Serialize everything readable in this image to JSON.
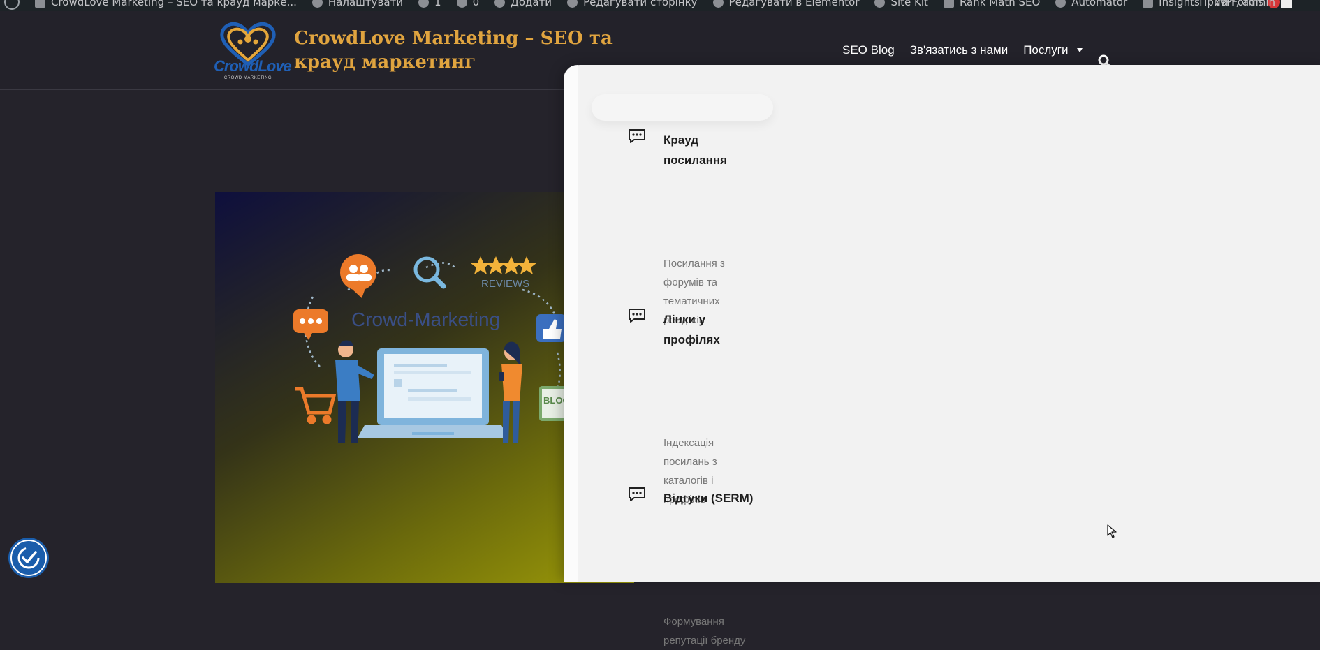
{
  "admin_bar": {
    "items": [
      {
        "label": "CrowdLove Marketing – SEO та крауд маркe...",
        "icon": "home-icon"
      },
      {
        "label": "Налаштувати",
        "icon": "brush-icon"
      },
      {
        "label": "1",
        "icon": "refresh-icon"
      },
      {
        "label": "0",
        "icon": "comment-icon"
      },
      {
        "label": "Додати",
        "icon": "plus-icon"
      },
      {
        "label": "Редагувати сторінку",
        "icon": "pencil-icon"
      },
      {
        "label": "Редагувати в Elementor",
        "icon": "elementor-icon"
      },
      {
        "label": "Site Kit",
        "icon": "sitekit-icon"
      },
      {
        "label": "Rank Math SEO",
        "icon": "rankmath-icon"
      },
      {
        "label": "Automator",
        "icon": "automator-icon"
      },
      {
        "label": "Insights",
        "icon": "insights-icon"
      },
      {
        "label": "WPForms",
        "icon": "wpforms-icon"
      }
    ],
    "greeting": "Привіт, admin"
  },
  "site": {
    "title": "CrowdLove Marketing – SEO та крауд маркетинг",
    "logo_text": "CrowdLove",
    "logo_subtext": "CROWD MARKETING"
  },
  "nav": {
    "items": [
      {
        "label": "SEO Blog"
      },
      {
        "label": "Зв'язатись з нами"
      },
      {
        "label": "Послуги"
      }
    ]
  },
  "hero": {
    "heading": "Crowd-Marketing",
    "reviews_label": "REVIEWS",
    "blog_label": "BLOG"
  },
  "mega_menu": {
    "services": [
      {
        "title": "Крауд посилання",
        "description": "Посилання з форумів та тематичних ресурсів"
      },
      {
        "title": "Лінки у профілях",
        "description": "Індексація посилань з каталогів і профілів"
      },
      {
        "title": "Відгуки (SERM)",
        "description": "Формування репутації бренду"
      }
    ]
  },
  "colors": {
    "brand_gold": "#e0a43f",
    "header_bg": "#23222a",
    "panel_bg": "#f2f2f2",
    "a11y_blue": "#1a5dab"
  }
}
